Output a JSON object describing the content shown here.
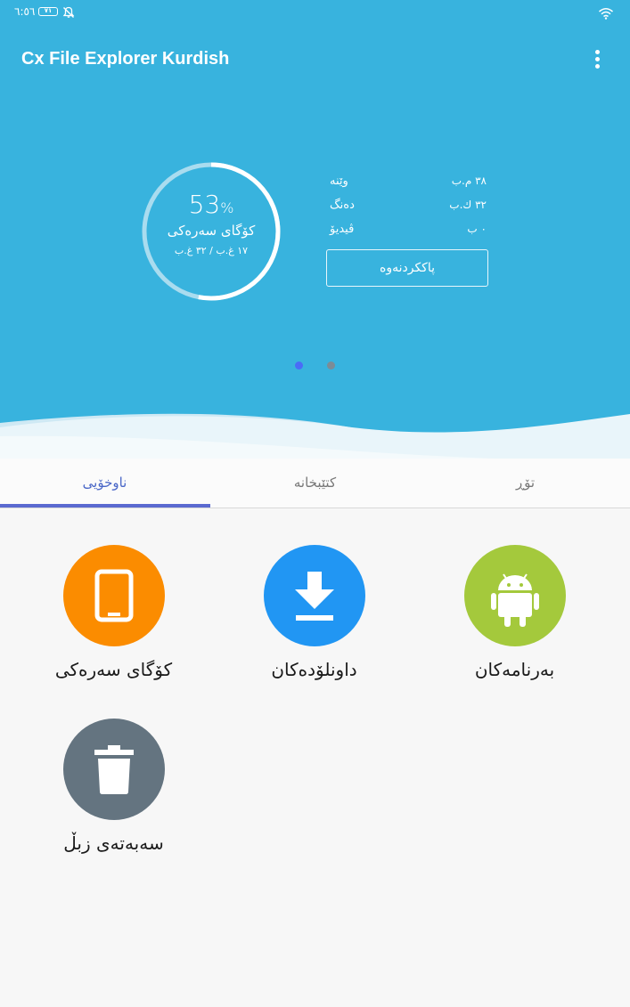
{
  "status_bar": {
    "time": "٦:٥٦",
    "battery": "٧١"
  },
  "header": {
    "title": "Cx File Explorer Kurdish",
    "background_color": "#38b3de"
  },
  "storage": {
    "percent": "53",
    "percent_sign": "%",
    "usage_fraction": 0.53,
    "label": "کۆگای سەرەکی",
    "size_text": "١٧ غ.ب / ٣٢ غ.ب"
  },
  "stats": [
    {
      "label": "وێنە",
      "value": "٣٨ م.ب"
    },
    {
      "label": "دەنگ",
      "value": "٣٢ ك.ب"
    },
    {
      "label": "ڤیدیۆ",
      "value": "٠ ب"
    }
  ],
  "clean_button_label": "پاککردنەوە",
  "pager": {
    "active_index": 0,
    "count": 2,
    "active_color": "#4a6cf7",
    "inactive_color": "#7c8c96"
  },
  "tabs": [
    {
      "label": "ناوخۆیی",
      "active": true
    },
    {
      "label": "کتێبخانە",
      "active": false
    },
    {
      "label": "تۆڕ",
      "active": false
    }
  ],
  "tiles": [
    {
      "label": "کۆگای سەرەکی",
      "icon": "phone-icon",
      "color": "#fb8c00"
    },
    {
      "label": "داونلۆدەکان",
      "icon": "download-icon",
      "color": "#2196f3"
    },
    {
      "label": "بەرنامەکان",
      "icon": "android-icon",
      "color": "#a4c93c"
    },
    {
      "label": "سەبەتەی زبڵ",
      "icon": "trash-icon",
      "color": "#647480"
    }
  ]
}
